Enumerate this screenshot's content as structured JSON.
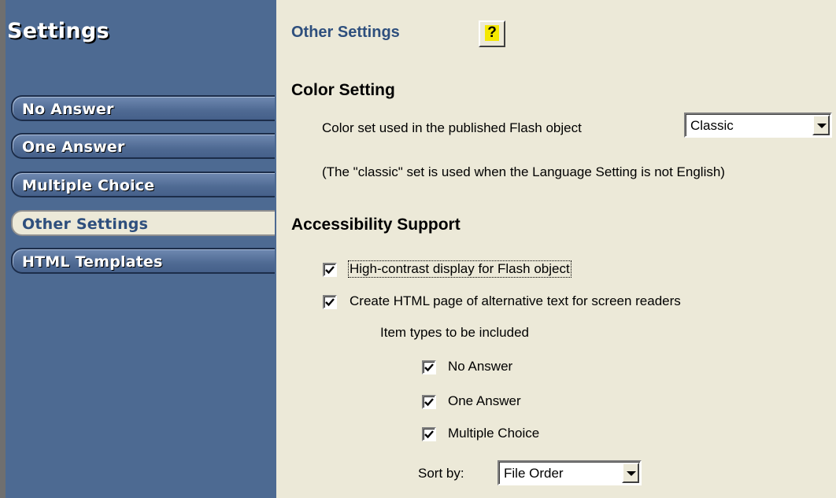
{
  "sidebar": {
    "title": "Settings",
    "items": [
      {
        "label": "No Answer",
        "active": false
      },
      {
        "label": "One Answer",
        "active": false
      },
      {
        "label": "Multiple Choice",
        "active": false
      },
      {
        "label": "Other Settings",
        "active": true
      },
      {
        "label": "HTML Templates",
        "active": false
      }
    ]
  },
  "main": {
    "section_title": "Other Settings",
    "help_label": "?",
    "color_setting": {
      "heading": "Color Setting",
      "label": "Color set used in the published Flash object",
      "select_value": "Classic",
      "note": "(The \"classic\" set is used when the Language Setting is not English)"
    },
    "accessibility": {
      "heading": "Accessibility Support",
      "high_contrast": {
        "label": "High-contrast display for Flash object",
        "checked": true
      },
      "alt_text": {
        "label": "Create HTML page of alternative text for screen readers",
        "checked": true
      },
      "item_types_label": "Item types to be included",
      "item_types": [
        {
          "label": "No Answer",
          "checked": true
        },
        {
          "label": "One Answer",
          "checked": true
        },
        {
          "label": "Multiple Choice",
          "checked": true
        }
      ],
      "sort_label": "Sort by:",
      "sort_value": "File Order"
    }
  },
  "colors": {
    "sidebar_bg": "#4d6a92",
    "panel_bg": "#ece9d8",
    "title_blue": "#2e4f7d",
    "help_yellow": "#f5e800"
  },
  "icons": [
    "help-icon",
    "dropdown-arrow-icon",
    "checkmark-icon"
  ]
}
